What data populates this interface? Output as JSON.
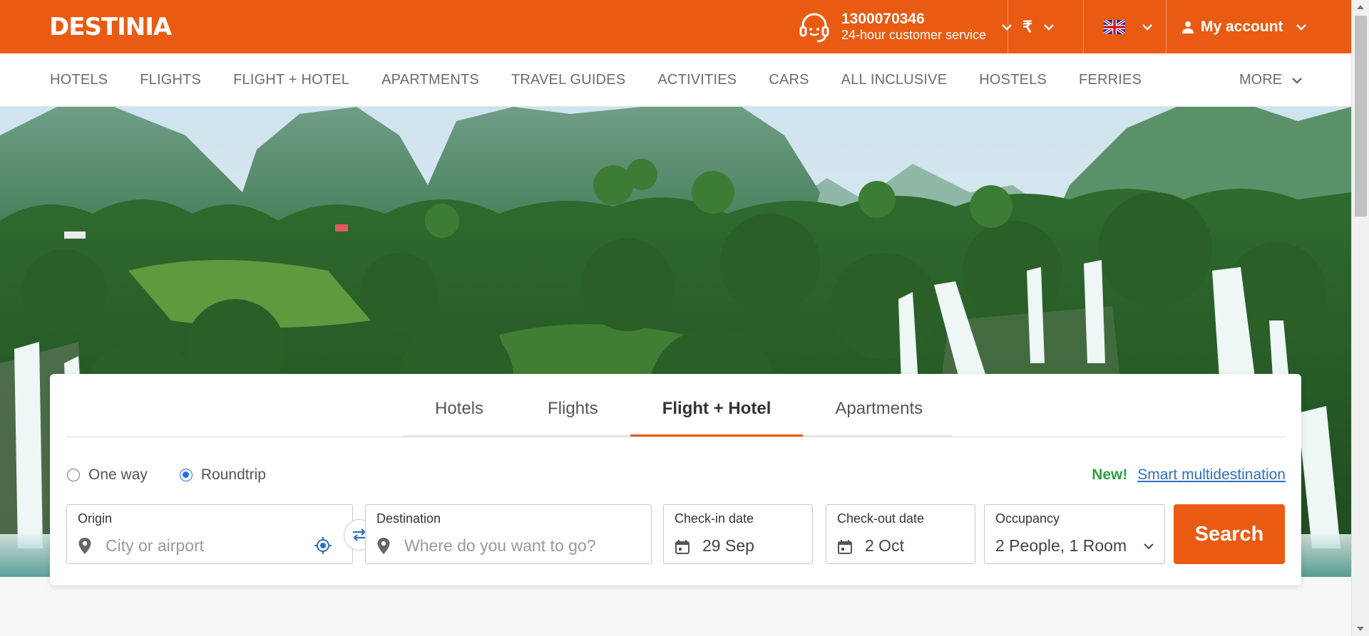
{
  "brand": {
    "logo_text": "DESTINIA"
  },
  "header": {
    "phone": "1300070346",
    "service_label": "24-hour customer service",
    "currency_symbol": "₹",
    "account_label": "My account"
  },
  "nav": {
    "items": [
      "HOTELS",
      "FLIGHTS",
      "FLIGHT + HOTEL",
      "APARTMENTS",
      "TRAVEL GUIDES",
      "ACTIVITIES",
      "CARS",
      "ALL INCLUSIVE",
      "HOSTELS",
      "FERRIES"
    ],
    "more_label": "MORE"
  },
  "search": {
    "tabs": [
      {
        "label": "Hotels",
        "active": false
      },
      {
        "label": "Flights",
        "active": false
      },
      {
        "label": "Flight + Hotel",
        "active": true
      },
      {
        "label": "Apartments",
        "active": false
      }
    ],
    "trip_types": [
      {
        "label": "One way",
        "checked": false
      },
      {
        "label": "Roundtrip",
        "checked": true
      }
    ],
    "new_badge": "New!",
    "multidestination_link": "Smart multidestination",
    "origin": {
      "label": "Origin",
      "placeholder": "City or airport"
    },
    "destination": {
      "label": "Destination",
      "placeholder": "Where do you want to go?"
    },
    "checkin": {
      "label": "Check-in date",
      "value": "29 Sep"
    },
    "checkout": {
      "label": "Check-out date",
      "value": "2 Oct"
    },
    "occupancy": {
      "label": "Occupancy",
      "value": "2 People, 1 Room"
    },
    "search_button": "Search"
  },
  "colors": {
    "brand_orange": "#e95b12",
    "link_blue": "#2f6fbf",
    "new_green": "#2ea043",
    "radio_blue": "#1a73e8"
  },
  "icons": [
    "headset-icon",
    "chevron-down-icon",
    "uk-flag-icon",
    "user-icon",
    "location-pin-icon",
    "locate-me-icon",
    "swap-icon",
    "calendar-icon"
  ]
}
